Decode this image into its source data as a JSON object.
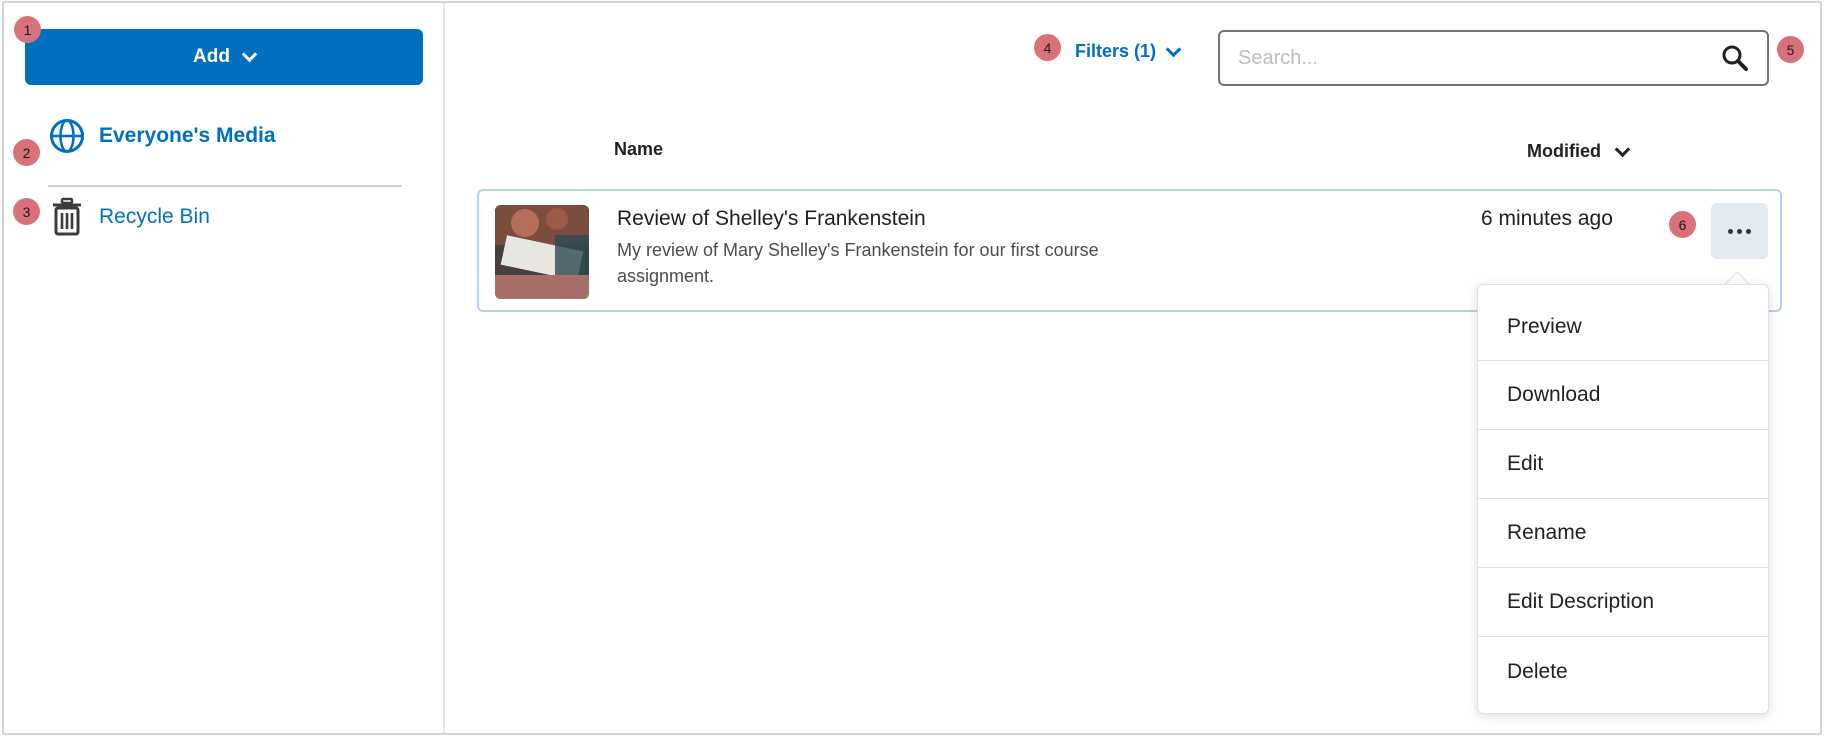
{
  "sidebar": {
    "add_button": "Add",
    "items": [
      {
        "label": "Everyone's Media",
        "icon": "globe-icon",
        "active": true
      },
      {
        "label": "Recycle Bin",
        "icon": "trash-icon",
        "active": false
      }
    ]
  },
  "toolbar": {
    "filters_label": "Filters (1)",
    "search_placeholder": "Search..."
  },
  "table": {
    "columns": {
      "name": "Name",
      "modified": "Modified"
    },
    "rows": [
      {
        "title": "Review of Shelley's Frankenstein",
        "description": "My review of Mary Shelley's Frankenstein for our first course assignment.",
        "modified": "6 minutes ago"
      }
    ]
  },
  "context_menu": {
    "items": [
      "Preview",
      "Download",
      "Edit",
      "Rename",
      "Edit Description",
      "Delete"
    ]
  },
  "callouts": [
    "1",
    "2",
    "3",
    "4",
    "5",
    "6"
  ],
  "colors": {
    "accent": "#006fbf",
    "badge": "#d9717a",
    "row_border": "#b9cfee"
  }
}
